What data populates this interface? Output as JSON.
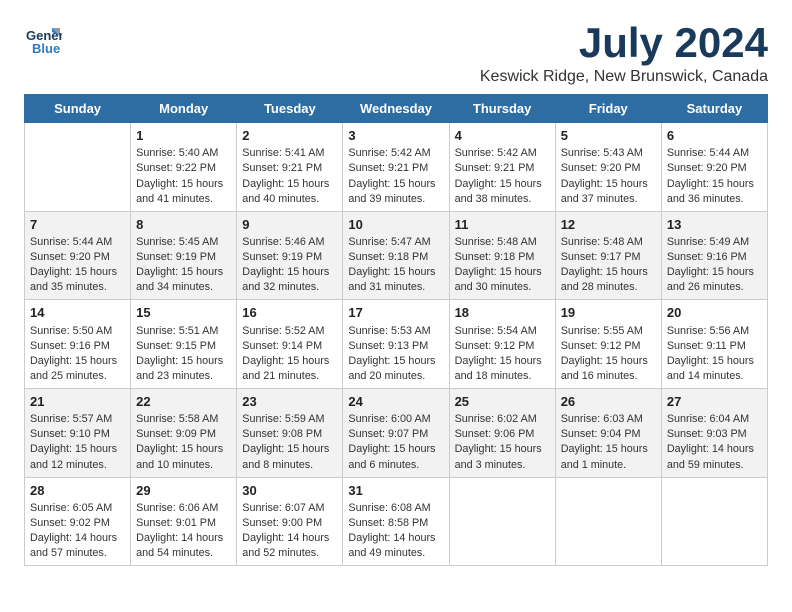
{
  "header": {
    "logo_line1": "General",
    "logo_line2": "Blue",
    "month": "July 2024",
    "location": "Keswick Ridge, New Brunswick, Canada"
  },
  "days_of_week": [
    "Sunday",
    "Monday",
    "Tuesday",
    "Wednesday",
    "Thursday",
    "Friday",
    "Saturday"
  ],
  "weeks": [
    [
      {
        "day": "",
        "info": ""
      },
      {
        "day": "1",
        "info": "Sunrise: 5:40 AM\nSunset: 9:22 PM\nDaylight: 15 hours\nand 41 minutes."
      },
      {
        "day": "2",
        "info": "Sunrise: 5:41 AM\nSunset: 9:21 PM\nDaylight: 15 hours\nand 40 minutes."
      },
      {
        "day": "3",
        "info": "Sunrise: 5:42 AM\nSunset: 9:21 PM\nDaylight: 15 hours\nand 39 minutes."
      },
      {
        "day": "4",
        "info": "Sunrise: 5:42 AM\nSunset: 9:21 PM\nDaylight: 15 hours\nand 38 minutes."
      },
      {
        "day": "5",
        "info": "Sunrise: 5:43 AM\nSunset: 9:20 PM\nDaylight: 15 hours\nand 37 minutes."
      },
      {
        "day": "6",
        "info": "Sunrise: 5:44 AM\nSunset: 9:20 PM\nDaylight: 15 hours\nand 36 minutes."
      }
    ],
    [
      {
        "day": "7",
        "info": "Sunrise: 5:44 AM\nSunset: 9:20 PM\nDaylight: 15 hours\nand 35 minutes."
      },
      {
        "day": "8",
        "info": "Sunrise: 5:45 AM\nSunset: 9:19 PM\nDaylight: 15 hours\nand 34 minutes."
      },
      {
        "day": "9",
        "info": "Sunrise: 5:46 AM\nSunset: 9:19 PM\nDaylight: 15 hours\nand 32 minutes."
      },
      {
        "day": "10",
        "info": "Sunrise: 5:47 AM\nSunset: 9:18 PM\nDaylight: 15 hours\nand 31 minutes."
      },
      {
        "day": "11",
        "info": "Sunrise: 5:48 AM\nSunset: 9:18 PM\nDaylight: 15 hours\nand 30 minutes."
      },
      {
        "day": "12",
        "info": "Sunrise: 5:48 AM\nSunset: 9:17 PM\nDaylight: 15 hours\nand 28 minutes."
      },
      {
        "day": "13",
        "info": "Sunrise: 5:49 AM\nSunset: 9:16 PM\nDaylight: 15 hours\nand 26 minutes."
      }
    ],
    [
      {
        "day": "14",
        "info": "Sunrise: 5:50 AM\nSunset: 9:16 PM\nDaylight: 15 hours\nand 25 minutes."
      },
      {
        "day": "15",
        "info": "Sunrise: 5:51 AM\nSunset: 9:15 PM\nDaylight: 15 hours\nand 23 minutes."
      },
      {
        "day": "16",
        "info": "Sunrise: 5:52 AM\nSunset: 9:14 PM\nDaylight: 15 hours\nand 21 minutes."
      },
      {
        "day": "17",
        "info": "Sunrise: 5:53 AM\nSunset: 9:13 PM\nDaylight: 15 hours\nand 20 minutes."
      },
      {
        "day": "18",
        "info": "Sunrise: 5:54 AM\nSunset: 9:12 PM\nDaylight: 15 hours\nand 18 minutes."
      },
      {
        "day": "19",
        "info": "Sunrise: 5:55 AM\nSunset: 9:12 PM\nDaylight: 15 hours\nand 16 minutes."
      },
      {
        "day": "20",
        "info": "Sunrise: 5:56 AM\nSunset: 9:11 PM\nDaylight: 15 hours\nand 14 minutes."
      }
    ],
    [
      {
        "day": "21",
        "info": "Sunrise: 5:57 AM\nSunset: 9:10 PM\nDaylight: 15 hours\nand 12 minutes."
      },
      {
        "day": "22",
        "info": "Sunrise: 5:58 AM\nSunset: 9:09 PM\nDaylight: 15 hours\nand 10 minutes."
      },
      {
        "day": "23",
        "info": "Sunrise: 5:59 AM\nSunset: 9:08 PM\nDaylight: 15 hours\nand 8 minutes."
      },
      {
        "day": "24",
        "info": "Sunrise: 6:00 AM\nSunset: 9:07 PM\nDaylight: 15 hours\nand 6 minutes."
      },
      {
        "day": "25",
        "info": "Sunrise: 6:02 AM\nSunset: 9:06 PM\nDaylight: 15 hours\nand 3 minutes."
      },
      {
        "day": "26",
        "info": "Sunrise: 6:03 AM\nSunset: 9:04 PM\nDaylight: 15 hours\nand 1 minute."
      },
      {
        "day": "27",
        "info": "Sunrise: 6:04 AM\nSunset: 9:03 PM\nDaylight: 14 hours\nand 59 minutes."
      }
    ],
    [
      {
        "day": "28",
        "info": "Sunrise: 6:05 AM\nSunset: 9:02 PM\nDaylight: 14 hours\nand 57 minutes."
      },
      {
        "day": "29",
        "info": "Sunrise: 6:06 AM\nSunset: 9:01 PM\nDaylight: 14 hours\nand 54 minutes."
      },
      {
        "day": "30",
        "info": "Sunrise: 6:07 AM\nSunset: 9:00 PM\nDaylight: 14 hours\nand 52 minutes."
      },
      {
        "day": "31",
        "info": "Sunrise: 6:08 AM\nSunset: 8:58 PM\nDaylight: 14 hours\nand 49 minutes."
      },
      {
        "day": "",
        "info": ""
      },
      {
        "day": "",
        "info": ""
      },
      {
        "day": "",
        "info": ""
      }
    ]
  ]
}
